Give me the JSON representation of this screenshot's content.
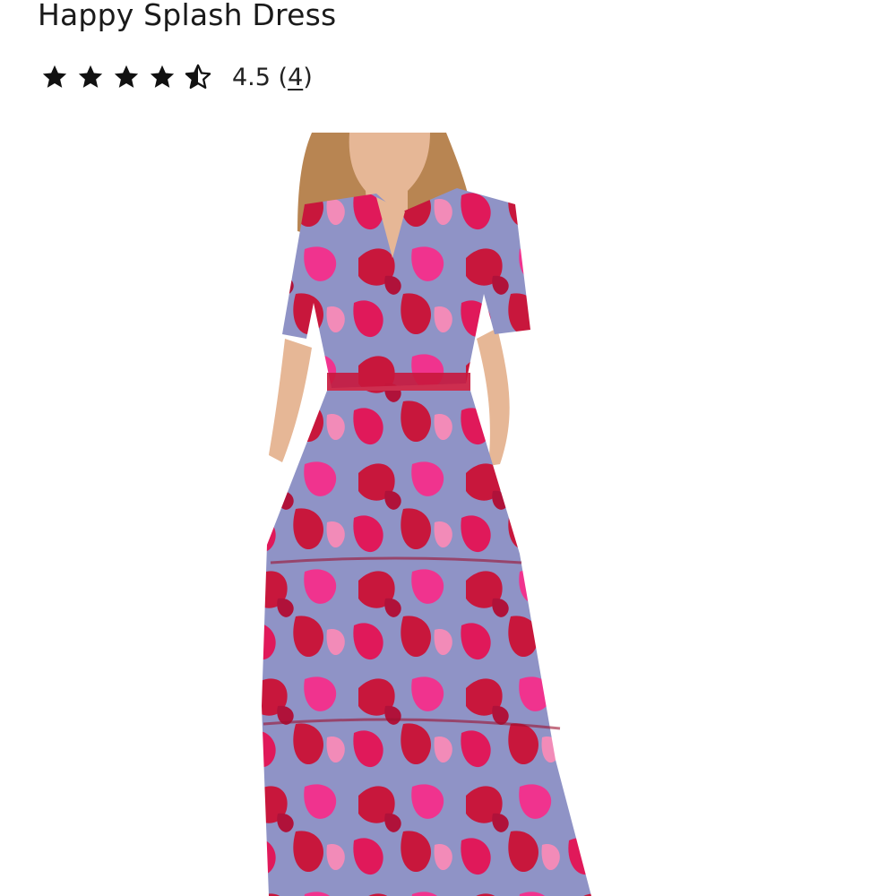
{
  "product": {
    "title": "Happy Splash Dress",
    "rating": {
      "value": 4.5,
      "value_text": "4.5",
      "review_count": "4",
      "open_paren": " (",
      "close_paren": ")",
      "max_stars": 5
    },
    "image": {
      "subject": "model wearing a pink and red floral print tiered maxi dress",
      "colors": {
        "primary_red": "#c8173c",
        "hot_pink": "#f0338e",
        "lavender_blue": "#8f93c6",
        "skin": "#e6b796",
        "hair": "#b88552"
      }
    }
  },
  "colors": {
    "text": "#1a1a1a",
    "star": "#111111",
    "background": "#ffffff"
  },
  "icons": [
    "star-full-icon",
    "star-half-icon"
  ]
}
